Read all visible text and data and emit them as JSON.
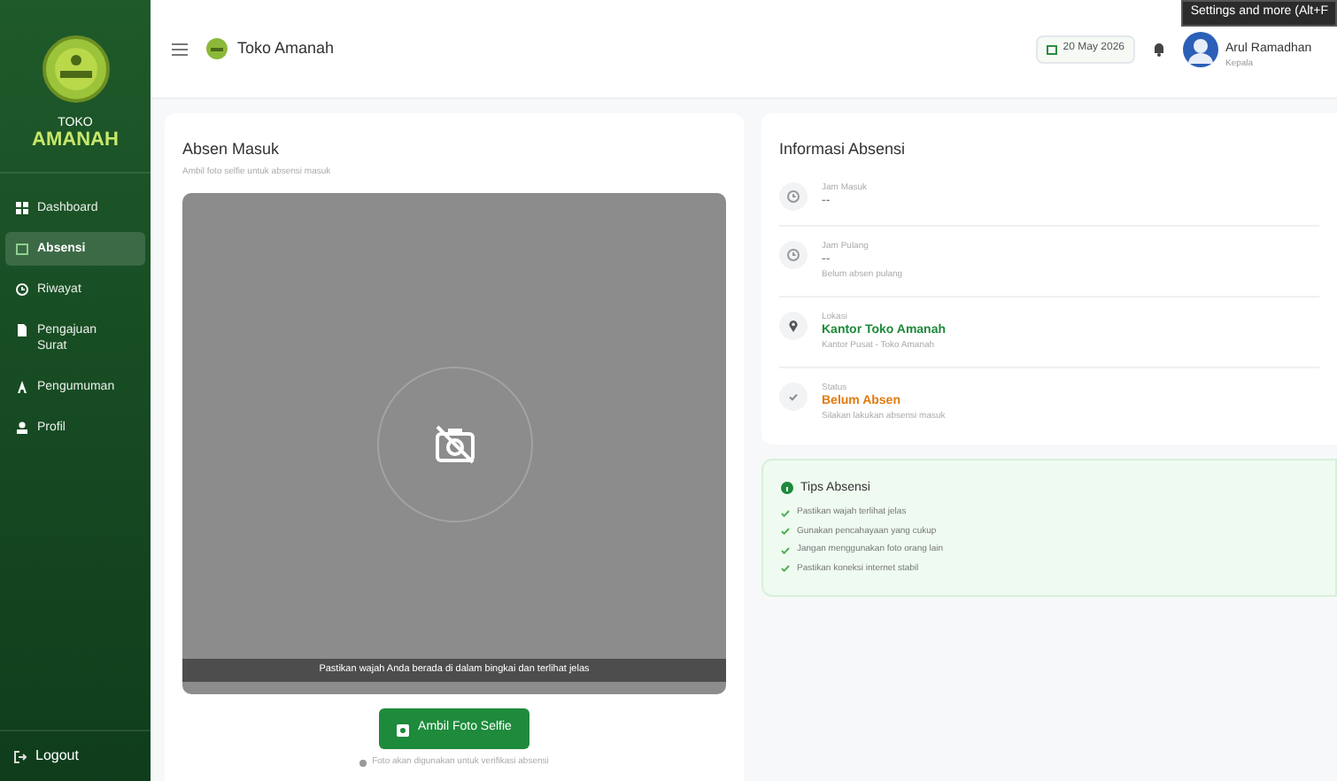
{
  "sidebar": {
    "brand_top": "TOKO",
    "brand_bottom": "AMANAH",
    "items": [
      {
        "label": "Dashboard",
        "selected": false
      },
      {
        "label": "Absensi",
        "selected": true
      },
      {
        "label": "Riwayat",
        "selected": false
      },
      {
        "label": "Pengajuan Surat",
        "selected": false
      },
      {
        "label": "Pengumuman",
        "selected": false
      },
      {
        "label": "Profil",
        "selected": false
      }
    ],
    "logout": "Logout"
  },
  "header": {
    "title": "Toko Amanah",
    "date": "20 May 2026",
    "user_name": "Arul Ramadhan",
    "user_role": "Kepala",
    "tooltip": "Settings and more (Alt+F"
  },
  "absen": {
    "title": "Absen Masuk",
    "subtitle": "Ambil foto selfie untuk absensi masuk",
    "camera_caption": "Pastikan wajah Anda berada di dalam bingkai dan terlihat jelas",
    "button": "Ambil Foto Selfie",
    "note": "Foto akan digunakan untuk verifikasi absensi"
  },
  "info": {
    "title": "Informasi Absensi",
    "items": [
      {
        "label": "Jam Masuk",
        "value": "--"
      },
      {
        "label": "Jam Pulang",
        "value": "--",
        "detail": "Belum absen pulang"
      },
      {
        "label": "Lokasi",
        "value": "Kantor Toko Amanah",
        "detail": "Kantor Pusat - Toko Amanah",
        "color": "#1e8a3b"
      },
      {
        "label": "Status",
        "value": "Belum Absen",
        "detail": "Silakan lakukan absensi masuk",
        "color": "#e07b12"
      }
    ]
  },
  "tips": {
    "title": "Tips Absensi",
    "items": [
      "Pastikan wajah terlihat jelas",
      "Gunakan pencahayaan yang cukup",
      "Jangan menggunakan foto orang lain",
      "Pastikan koneksi internet stabil"
    ]
  }
}
